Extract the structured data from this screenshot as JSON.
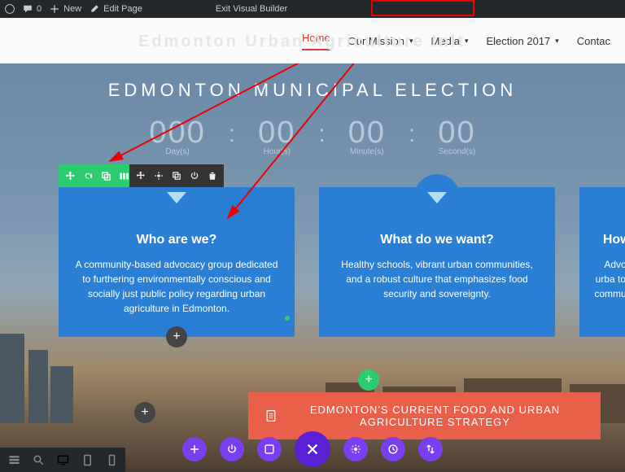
{
  "adminbar": {
    "comments": "0",
    "new": "New",
    "edit": "Edit Page",
    "exit": "Exit Visual Builder"
  },
  "nav": {
    "ghost": "Edmonton Urban Agriculture Init",
    "items": [
      "Home",
      "Our Mission",
      "Media",
      "Election 2017",
      "Contac"
    ]
  },
  "hero": {
    "title": "EDMONTON MUNICIPAL ELECTION",
    "countdown": [
      {
        "num": "000",
        "label": "Day(s)"
      },
      {
        "num": "00",
        "label": "Hour(s)"
      },
      {
        "num": "00",
        "label": "Minute(s)"
      },
      {
        "num": "00",
        "label": "Second(s)"
      }
    ]
  },
  "cards": [
    {
      "title": "Who are we?",
      "body": "A community-based advocacy group dedicated to furthering environmentally conscious and socially just public policy regarding urban agriculture in Edmonton."
    },
    {
      "title": "What do we want?",
      "body": "Healthy schools, vibrant urban communities, and a robust culture that emphasizes food security and  sovereignty."
    },
    {
      "title": "How car",
      "body": "Advocating urba       to bring to       communities so"
    }
  ],
  "strategy": "EDMONTON'S CURRENT FOOD AND URBAN AGRICULTURE STRATEGY",
  "colors": {
    "accent": "#2ecc71",
    "card": "#2a7fd4",
    "purple": "#7b3ff2",
    "red": "#e95f4a"
  }
}
